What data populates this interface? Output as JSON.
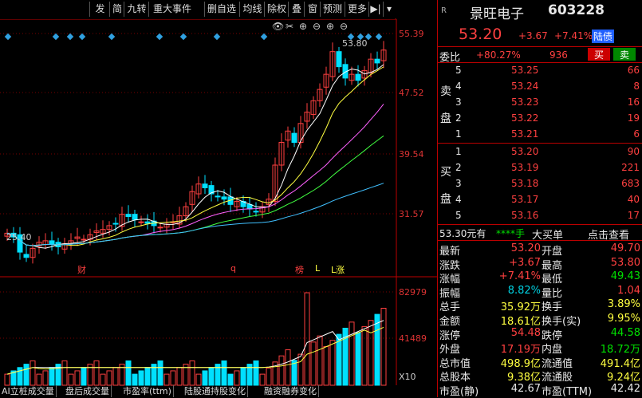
{
  "toolbar": {
    "buttons": [
      "发",
      "简",
      "九转",
      "重大事件",
      "删自选",
      "均线",
      "除权",
      "叠",
      "窗",
      "预测",
      "更多"
    ]
  },
  "chart": {
    "price_labels": [
      "55.39",
      "47.52",
      "39.54",
      "31.57"
    ],
    "peak_label": "53.80",
    "low_label": "25.40",
    "event_labels": [
      "财",
      "q",
      "榜",
      "L",
      "L涨"
    ],
    "volume_labels": [
      "82979",
      "41489"
    ],
    "volume_unit": "X10"
  },
  "chart_data": {
    "type": "candlestick",
    "title": "",
    "price_ticks": [
      55.39,
      47.52,
      39.54,
      31.57
    ],
    "price_range": [
      23.6,
      56.5
    ],
    "high": 53.8,
    "low": 25.4,
    "volume_ticks": [
      82979,
      41489
    ],
    "volume_unit": "X10"
  },
  "panel": {
    "market_tag": "R",
    "stock_name": "景旺电子",
    "stock_code": "603228",
    "price": "53.20",
    "change": "+3.67",
    "change_pct": "+7.41%",
    "market_badge": "陆债",
    "weibi_label": "委比",
    "weibi_value": "+80.27%",
    "weibi_diff": "936",
    "buy_btn": "买",
    "sell_btn": "卖",
    "sell_side_label": [
      "卖",
      "盘"
    ],
    "buy_side_label": [
      "买",
      "盘"
    ],
    "asks": [
      {
        "level": "5",
        "price": "53.25",
        "vol": "66"
      },
      {
        "level": "4",
        "price": "53.24",
        "vol": "8"
      },
      {
        "level": "3",
        "price": "53.23",
        "vol": "16"
      },
      {
        "level": "2",
        "price": "53.22",
        "vol": "19"
      },
      {
        "level": "1",
        "price": "53.21",
        "vol": "6"
      }
    ],
    "bids": [
      {
        "level": "1",
        "price": "53.20",
        "vol": "90"
      },
      {
        "level": "2",
        "price": "53.19",
        "vol": "221"
      },
      {
        "level": "3",
        "price": "53.18",
        "vol": "683"
      },
      {
        "level": "4",
        "price": "53.17",
        "vol": "40"
      },
      {
        "level": "5",
        "price": "53.16",
        "vol": "17"
      }
    ],
    "trade_line": {
      "price": "53.30元有",
      "stars": "****手",
      "type": "大买单",
      "action": "点击查看"
    },
    "stats": [
      {
        "l1": "最新",
        "v1": "53.20",
        "c1": "red",
        "l2": "开盘",
        "v2": "49.70",
        "c2": "red"
      },
      {
        "l1": "涨跌",
        "v1": "+3.67",
        "c1": "red",
        "l2": "最高",
        "v2": "53.80",
        "c2": "red"
      },
      {
        "l1": "涨幅",
        "v1": "+7.41%",
        "c1": "red",
        "l2": "最低",
        "v2": "49.43",
        "c2": "green"
      },
      {
        "l1": "振幅",
        "v1": "8.82%",
        "c1": "cyan",
        "l2": "量比",
        "v2": "1.04",
        "c2": "red"
      },
      {
        "l1": "总手",
        "v1": "35.92万",
        "c1": "yellow",
        "l2": "换手",
        "v2": "3.89%",
        "c2": "yellow"
      },
      {
        "l1": "金额",
        "v1": "18.61亿",
        "c1": "yellow",
        "l2": "换手(实)",
        "v2": "9.95%",
        "c2": "yellow"
      },
      {
        "l1": "涨停",
        "v1": "54.48",
        "c1": "red",
        "l2": "跌停",
        "v2": "44.58",
        "c2": "green"
      },
      {
        "l1": "外盘",
        "v1": "17.19万",
        "c1": "red",
        "l2": "内盘",
        "v2": "18.72万",
        "c2": "green"
      },
      {
        "l1": "总市值",
        "v1": "498.9亿",
        "c1": "yellow",
        "l2": "流通值",
        "v2": "491.4亿",
        "c2": "yellow"
      },
      {
        "l1": "总股本",
        "v1": "9.38亿",
        "c1": "yellow",
        "l2": "流通股",
        "v2": "9.24亿",
        "c2": "yellow"
      },
      {
        "l1": "市盈(静)",
        "v1": "42.67",
        "c1": "white",
        "l2": "市盈(TTM)",
        "v2": "42.42",
        "c2": "white"
      }
    ]
  },
  "bottom_tabs": [
    "AI立桩成交量",
    "盘后成交量",
    "市盈率(ttm)",
    "陆股通持股变化",
    "融资融券变化"
  ],
  "colors": {
    "up": "#ff4040",
    "down": "#00e0ff",
    "border": "#b00000"
  }
}
